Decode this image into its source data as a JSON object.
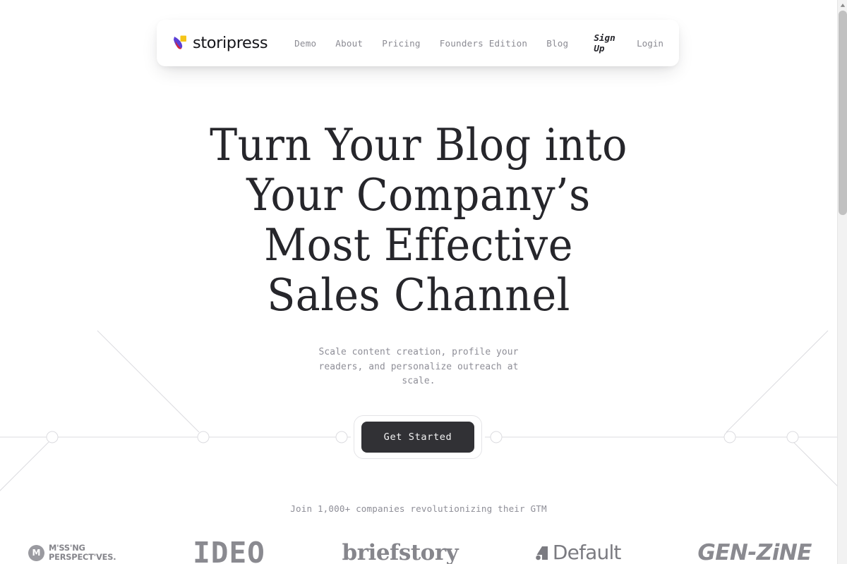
{
  "brand": {
    "name": "storipress",
    "mark": "storipress-logo-mark",
    "mark_colors": {
      "swoosh_purple": "#5b3fd6",
      "swoosh_red": "#d4273f",
      "square_yellow": "#f5c518"
    }
  },
  "nav": {
    "links": [
      {
        "label": "Demo",
        "name": "nav-link-demo"
      },
      {
        "label": "About",
        "name": "nav-link-about"
      },
      {
        "label": "Pricing",
        "name": "nav-link-pricing"
      },
      {
        "label": "Founders Edition",
        "name": "nav-link-founders-edition"
      },
      {
        "label": "Blog",
        "name": "nav-link-blog"
      }
    ],
    "signup": "Sign Up",
    "login": "Login"
  },
  "hero": {
    "headline": "Turn Your Blog into Your Company’s Most Effective Sales Channel",
    "subheadline": "Scale content creation, profile your readers, and personalize outreach at scale.",
    "cta_label": "Get Started"
  },
  "social_proof": {
    "text": "Join 1,000+ companies revolutionizing their GTM",
    "logos": [
      {
        "name": "logo-missing-perspectives",
        "line1": "M'SS'NG",
        "line2": "PERSPECT'VES.",
        "badge": "M"
      },
      {
        "name": "logo-ideo",
        "label": "IDEO"
      },
      {
        "name": "logo-briefstory",
        "label": "briefstory"
      },
      {
        "name": "logo-default",
        "label": "Default"
      },
      {
        "name": "logo-gen-zine",
        "label": "GEN-ZiNE"
      }
    ]
  },
  "colors": {
    "page_background": "#ffffff",
    "headline": "#26262b",
    "muted_text": "#8e8e97",
    "cta_background": "#313135",
    "decor_line": "#dcdce0"
  },
  "scrollbar": {
    "up_arrow": "scroll-up-arrow"
  }
}
